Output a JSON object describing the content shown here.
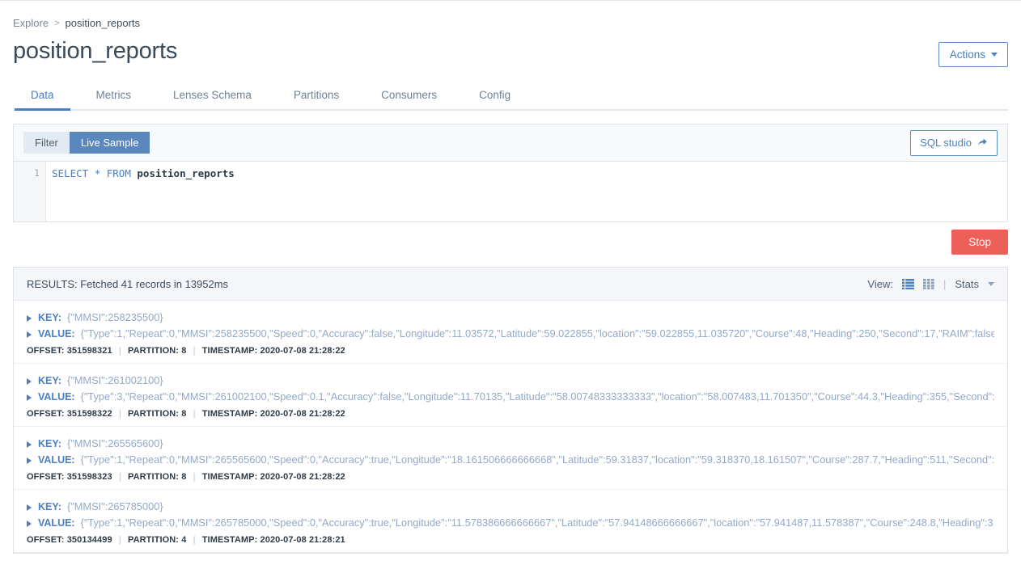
{
  "breadcrumb": {
    "root": "Explore",
    "separator": ">",
    "current": "position_reports"
  },
  "header": {
    "title": "position_reports",
    "actions_label": "Actions"
  },
  "tabs": [
    {
      "label": "Data",
      "active": true
    },
    {
      "label": "Metrics",
      "active": false
    },
    {
      "label": "Lenses Schema",
      "active": false
    },
    {
      "label": "Partitions",
      "active": false
    },
    {
      "label": "Consumers",
      "active": false
    },
    {
      "label": "Config",
      "active": false
    }
  ],
  "query": {
    "mode_buttons": [
      {
        "label": "Filter",
        "active": false
      },
      {
        "label": "Live Sample",
        "active": true
      }
    ],
    "sql_studio_label": "SQL studio",
    "sql_studio_icon": "share-arrow-icon",
    "line_number": "1",
    "sql_keyword_select": "SELECT",
    "sql_star": "*",
    "sql_keyword_from": "FROM",
    "sql_table": "position_reports",
    "stop_label": "Stop"
  },
  "results": {
    "summary": "RESULTS: Fetched 41 records in 13952ms",
    "view_label": "View:",
    "list_icon": "list-view-icon",
    "grid_icon": "grid-view-icon",
    "divider": "|",
    "stats_label": "Stats",
    "records": [
      {
        "key_label": "KEY:",
        "key_value": "{\"MMSI\":258235500}",
        "value_label": "VALUE:",
        "value_json": "{\"Type\":1,\"Repeat\":0,\"MMSI\":258235500,\"Speed\":0,\"Accuracy\":false,\"Longitude\":11.03572,\"Latitude\":59.022855,\"location\":\"59.022855,11.035720\",\"Course\":48,\"Heading\":250,\"Second\":17,\"RAIM\":false,",
        "offset_label": "OFFSET:",
        "offset": "351598321",
        "partition_label": "PARTITION:",
        "partition": "8",
        "timestamp_label": "TIMESTAMP:",
        "timestamp": "2020-07-08 21:28:22"
      },
      {
        "key_label": "KEY:",
        "key_value": "{\"MMSI\":261002100}",
        "value_label": "VALUE:",
        "value_json": "{\"Type\":3,\"Repeat\":0,\"MMSI\":261002100,\"Speed\":0.1,\"Accuracy\":false,\"Longitude\":11.70135,\"Latitude\":\"58.00748333333333\",\"location\":\"58.007483,11.701350\",\"Course\":44.3,\"Heading\":355,\"Second\":",
        "offset_label": "OFFSET:",
        "offset": "351598322",
        "partition_label": "PARTITION:",
        "partition": "8",
        "timestamp_label": "TIMESTAMP:",
        "timestamp": "2020-07-08 21:28:22"
      },
      {
        "key_label": "KEY:",
        "key_value": "{\"MMSI\":265565600}",
        "value_label": "VALUE:",
        "value_json": "{\"Type\":1,\"Repeat\":0,\"MMSI\":265565600,\"Speed\":0,\"Accuracy\":true,\"Longitude\":\"18.161506666666668\",\"Latitude\":59.31837,\"location\":\"59.318370,18.161507\",\"Course\":287.7,\"Heading\":511,\"Second\":1",
        "offset_label": "OFFSET:",
        "offset": "351598323",
        "partition_label": "PARTITION:",
        "partition": "8",
        "timestamp_label": "TIMESTAMP:",
        "timestamp": "2020-07-08 21:28:22"
      },
      {
        "key_label": "KEY:",
        "key_value": "{\"MMSI\":265785000}",
        "value_label": "VALUE:",
        "value_json": "{\"Type\":1,\"Repeat\":0,\"MMSI\":265785000,\"Speed\":0,\"Accuracy\":true,\"Longitude\":\"11.578386666666667\",\"Latitude\":\"57.94148666666667\",\"location\":\"57.941487,11.578387\",\"Course\":248.8,\"Heading\":3",
        "offset_label": "OFFSET:",
        "offset": "350134499",
        "partition_label": "PARTITION:",
        "partition": "4",
        "timestamp_label": "TIMESTAMP:",
        "timestamp": "2020-07-08 21:28:21"
      }
    ]
  },
  "colors": {
    "accent": "#4a7fc1",
    "danger": "#ec6058",
    "muted": "#93a9c8",
    "text": "#3e4c59"
  }
}
